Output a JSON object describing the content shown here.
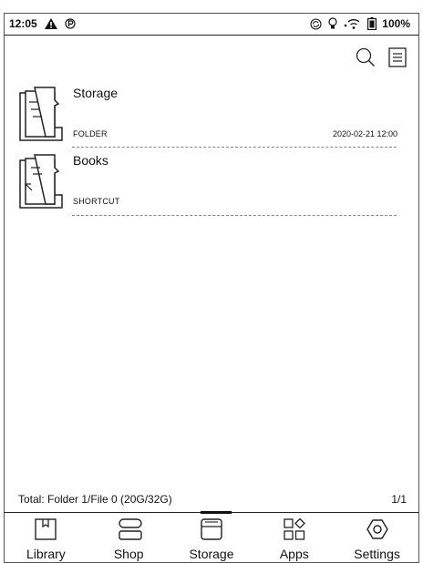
{
  "status_bar": {
    "time": "12:05",
    "battery": "100%"
  },
  "toolbar": {
    "search_icon": "search-icon",
    "menu_icon": "list-menu-icon"
  },
  "items": [
    {
      "name": "Storage",
      "type": "FOLDER",
      "date": "2020-02-21 12:00"
    },
    {
      "name": "Books",
      "type": "SHORTCUT",
      "date": ""
    }
  ],
  "footer": {
    "total": "Total:  Folder 1/File 0  (20G/32G)",
    "page": "1/1"
  },
  "nav": [
    {
      "label": "Library",
      "icon": "library-icon"
    },
    {
      "label": "Shop",
      "icon": "shop-icon"
    },
    {
      "label": "Storage",
      "icon": "storage-icon",
      "active": true
    },
    {
      "label": "Apps",
      "icon": "apps-icon"
    },
    {
      "label": "Settings",
      "icon": "settings-icon"
    }
  ]
}
